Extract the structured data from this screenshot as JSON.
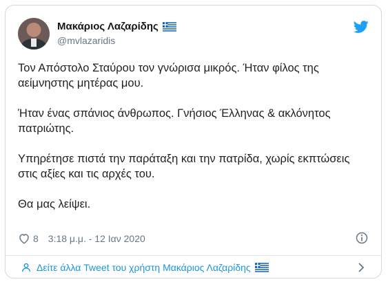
{
  "author": {
    "name": "Μακάριος Λαζαρίδης",
    "handle": "@mvlazaridis"
  },
  "tweet": {
    "paragraphs": [
      "Τον Απόστολο Σταύρου τον γνώρισα μικρός. Ήταν φίλος της αείμνηστης μητέρας μου.",
      "Ήταν ένας σπάνιος άνθρωπος. Γνήσιος Έλληνας & ακλόνητος πατριώτης.",
      "Υπηρέτησε πιστά την παράταξη και την πατρίδα, χωρίς εκπτώσεις στις αξίες και τις αρχές του.",
      "Θα μας λείψει."
    ]
  },
  "meta": {
    "likes": "8",
    "timestamp": "3:18 μ.μ. - 12 Ιαν 2020"
  },
  "footer": {
    "link_text": "Δείτε άλλα Tweet του χρήστη Μακάριος Λαζαρίδης"
  },
  "colors": {
    "link": "#1b95e0",
    "twitter_blue": "#1da1f2",
    "muted": "#657786",
    "border": "#cfd9de",
    "greek_blue": "#0d5eaf"
  },
  "icons": {
    "brand": "twitter-bird-icon",
    "like": "heart-icon",
    "info": "info-icon",
    "profile": "person-icon",
    "nav": "chevron-right-icon",
    "flag": "greek-flag-icon"
  }
}
